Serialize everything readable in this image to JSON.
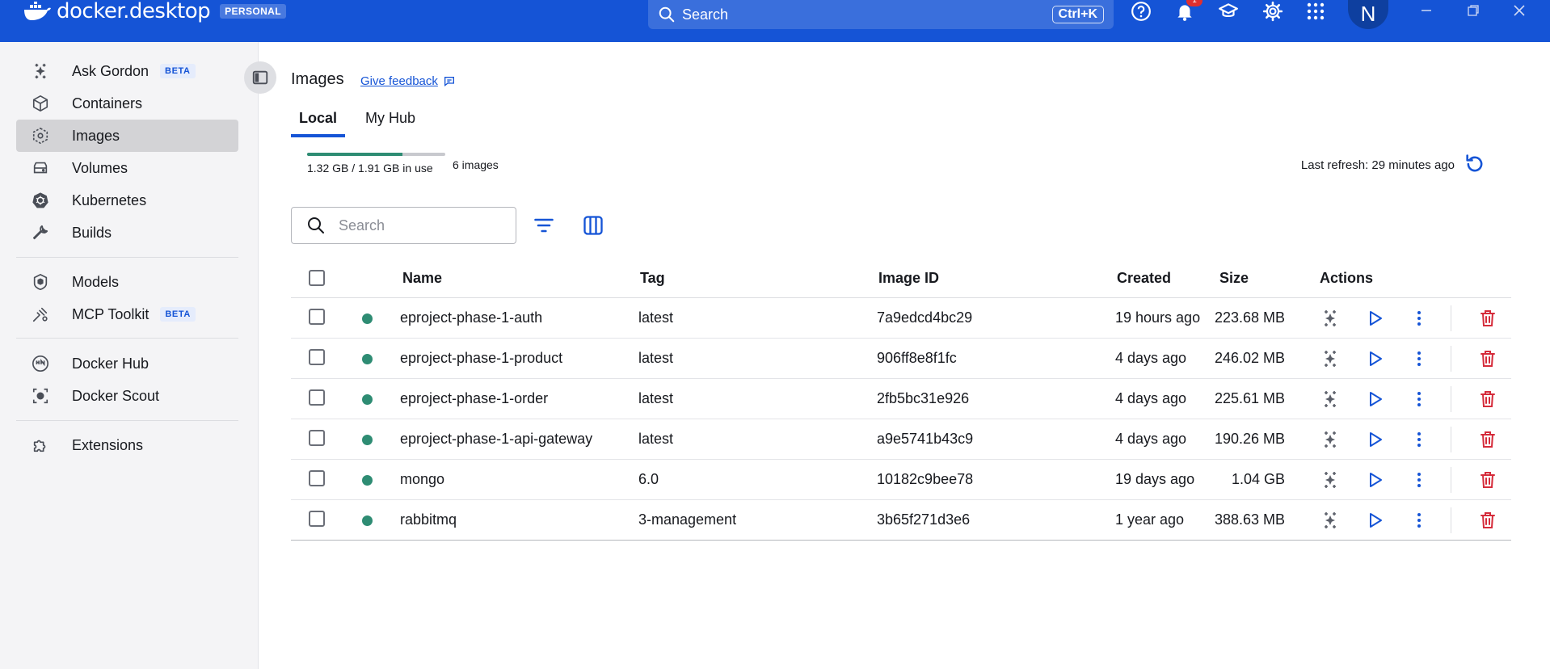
{
  "app": {
    "logo_text": "docker.desktop",
    "plan_badge": "PERSONAL",
    "search_label": "Search",
    "search_shortcut": "Ctrl+K",
    "notification_count": "1",
    "avatar_initial": "N"
  },
  "sidebar": {
    "items": [
      {
        "label": "Ask Gordon",
        "icon": "sparkle-icon",
        "badge": "BETA"
      },
      {
        "label": "Containers",
        "icon": "cube-icon"
      },
      {
        "label": "Images",
        "icon": "image-layers-icon",
        "active": true
      },
      {
        "label": "Volumes",
        "icon": "drive-icon"
      },
      {
        "label": "Kubernetes",
        "icon": "helm-icon"
      },
      {
        "label": "Builds",
        "icon": "wrench-icon"
      },
      {
        "label": "Models",
        "icon": "model-cube-icon"
      },
      {
        "label": "MCP Toolkit",
        "icon": "toolkit-icon",
        "badge": "BETA"
      },
      {
        "label": "Docker Hub",
        "icon": "hub-icon"
      },
      {
        "label": "Docker Scout",
        "icon": "scout-icon"
      },
      {
        "label": "Extensions",
        "icon": "puzzle-icon"
      }
    ]
  },
  "main": {
    "title": "Images",
    "feedback_label": "Give feedback",
    "tabs": [
      {
        "label": "Local",
        "active": true
      },
      {
        "label": "My Hub"
      }
    ],
    "usage": {
      "text": "1.32 GB / 1.91 GB in use",
      "count": "6 images",
      "fraction_used": 0.69
    },
    "last_refresh": "Last refresh: 29 minutes ago",
    "search_placeholder": "Search"
  },
  "table": {
    "columns": {
      "name": "Name",
      "tag": "Tag",
      "image_id": "Image ID",
      "created": "Created",
      "size": "Size",
      "actions": "Actions"
    },
    "rows": [
      {
        "name": "eproject-phase-1-auth",
        "tag": "latest",
        "image_id": "7a9edcd4bc29",
        "created": "19 hours ago",
        "size": "223.68 MB"
      },
      {
        "name": "eproject-phase-1-product",
        "tag": "latest",
        "image_id": "906ff8e8f1fc",
        "created": "4 days ago",
        "size": "246.02 MB"
      },
      {
        "name": "eproject-phase-1-order",
        "tag": "latest",
        "image_id": "2fb5bc31e926",
        "created": "4 days ago",
        "size": "225.61 MB"
      },
      {
        "name": "eproject-phase-1-api-gateway",
        "tag": "latest",
        "image_id": "a9e5741b43c9",
        "created": "4 days ago",
        "size": "190.26 MB"
      },
      {
        "name": "mongo",
        "tag": "6.0",
        "image_id": "10182c9bee78",
        "created": "19 days ago",
        "size": "1.04 GB"
      },
      {
        "name": "rabbitmq",
        "tag": "3-management",
        "image_id": "3b65f271d3e6",
        "created": "1 year ago",
        "size": "388.63 MB"
      }
    ]
  },
  "colors": {
    "brand": "#1554d6",
    "in_use_dot": "#2e8c73",
    "delete": "#d52b3a"
  }
}
